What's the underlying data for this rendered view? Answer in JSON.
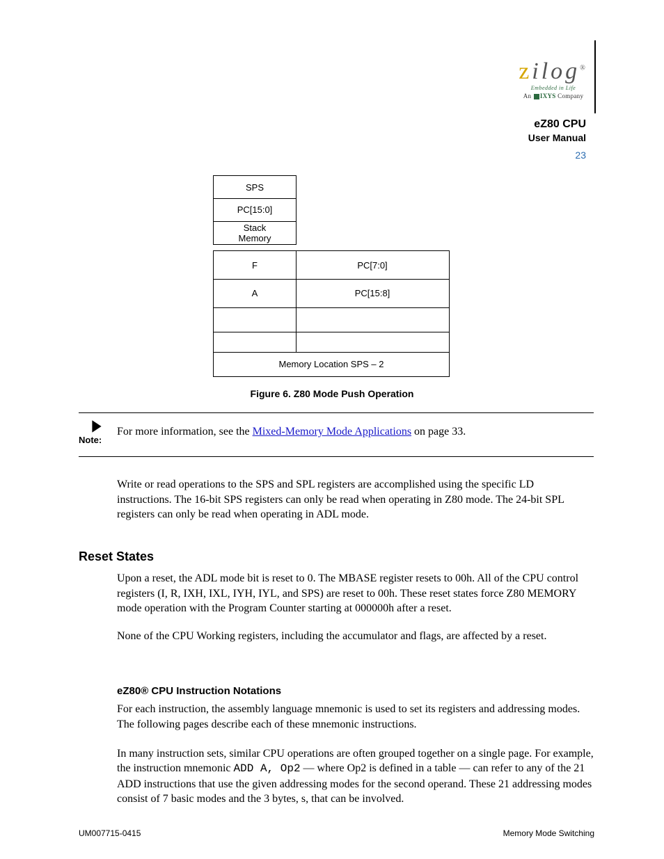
{
  "header": {
    "logo_z": "z",
    "logo_rest": "ilog",
    "logo_reg": "®",
    "tagline": "Embedded in Life",
    "subcompany_pre": "An ",
    "subcompany_ixys": "IXYS",
    "subcompany_post": " Company",
    "doc_title": "eZ80 CPU",
    "doc_sub": "User Manual",
    "page_num": "23"
  },
  "figure": {
    "rows": {
      "sps": "SPS",
      "pc_15_0": "PC[15:0]",
      "stack": "Stack\nMemory",
      "flags": "F",
      "pc_7_0": "PC[7:0]",
      "a": "A",
      "pc_15_8": "PC[15:8]",
      "full": "Memory Location SPS – 2"
    },
    "caption": "Figure 6. Z80 Mode Push Operation"
  },
  "note": {
    "label": "Note:",
    "text_pre": "For more information, see the ",
    "link": "Mixed-Memory Mode Applications",
    "text_post": " on page 33."
  },
  "body": {
    "p1": "Write or read operations to the SPS and SPL registers are accomplished using the specific LD instructions. The 16-bit SPS registers can only be read when operating in Z80 mode. The 24-bit SPL registers can only be read when operating in ADL mode.",
    "h_sect": "Reset States",
    "p2": "Upon a reset, the ADL mode bit is reset to 0. The MBASE register resets to 00h. All of the CPU control registers (I, R, IXH, IXL, IYH, IYL, and SPS) are reset to 00h. These reset states force Z80 MEMORY mode operation with the Program Counter starting at 000000h after a reset.",
    "p3": "None of the CPU Working registers, including the accumulator and flags, are affected by a reset.",
    "h_sub": "eZ80® CPU Instruction Notations",
    "p4": "For each instruction, the assembly language mnemonic is used to set its registers and addressing modes. The following pages describe each of these mnemonic instructions.",
    "p5_pre": "In many instruction sets, similar CPU operations are often grouped together on a single page. For example, the instruction mnemonic ",
    "p5_mono": "ADD A,  Op2",
    "p5_post": " — where Op2 is defined in a table — can refer to any of the 21 ADD instructions that use the given addressing modes for the second operand. These 21 addressing modes consist of 7 basic modes and the 3 bytes, s, that can be involved."
  },
  "footer": {
    "left": "UM007715-0415",
    "right": "Memory Mode Switching"
  }
}
